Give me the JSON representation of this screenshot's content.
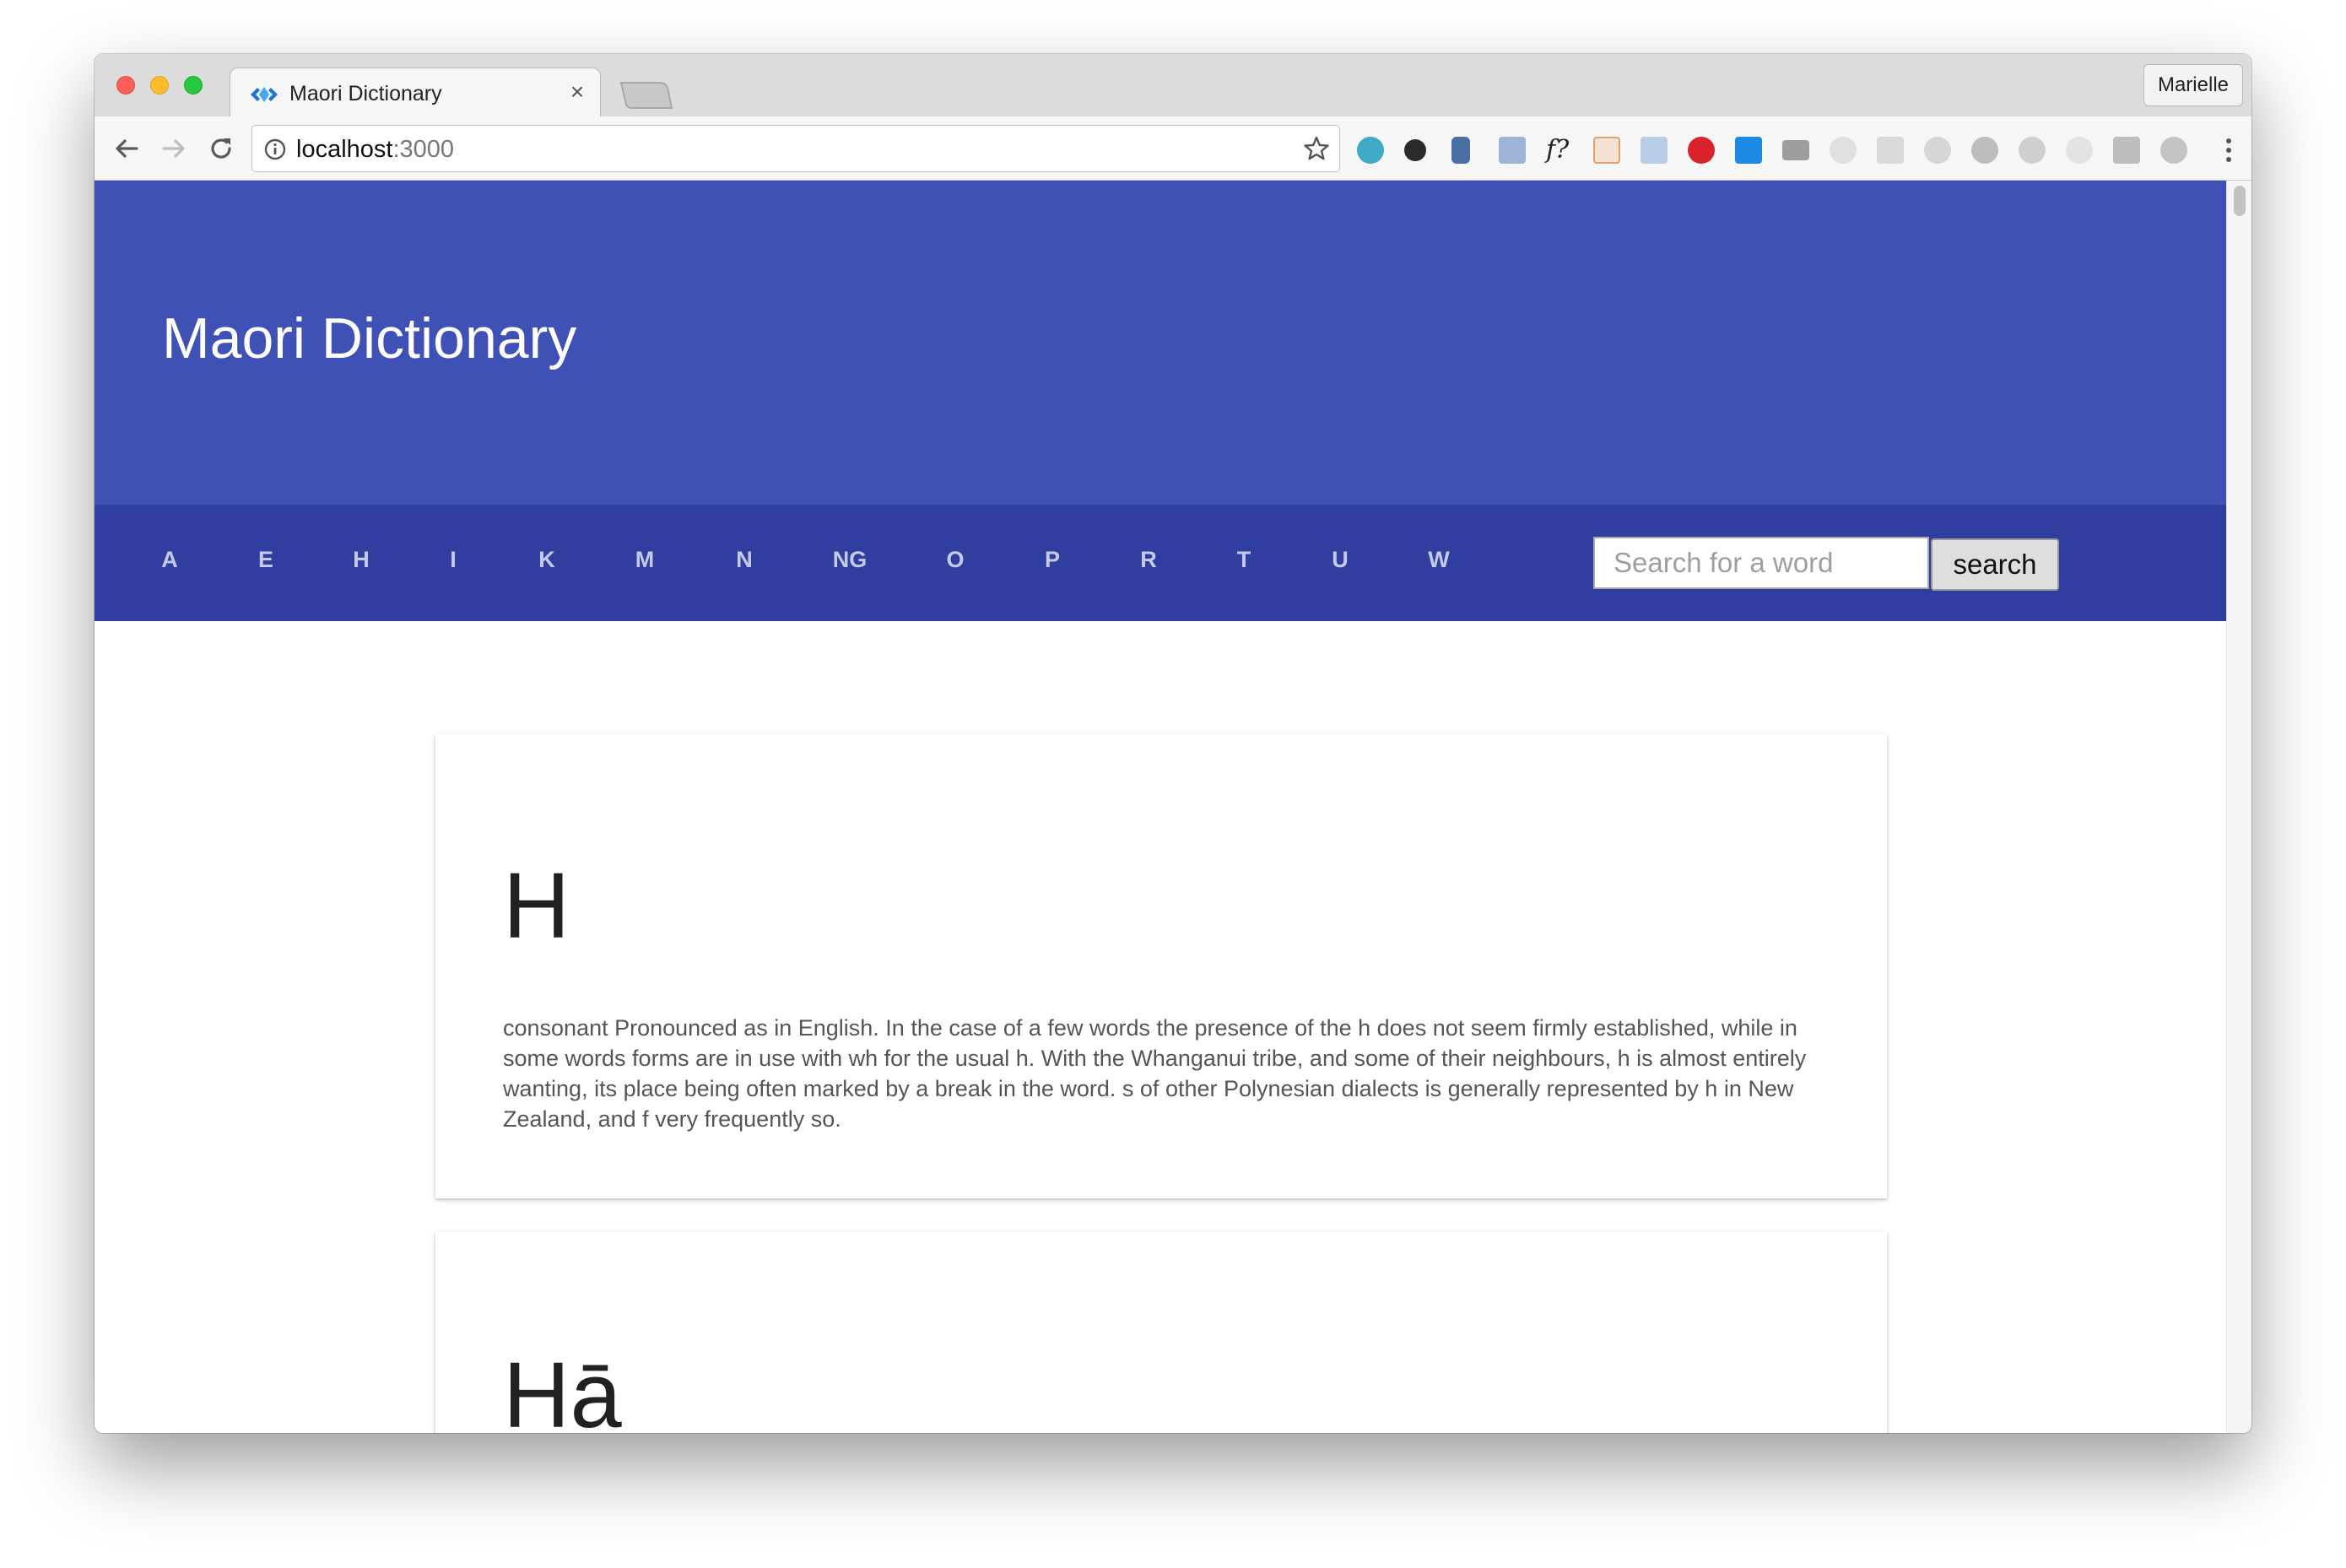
{
  "browser": {
    "tab": {
      "title": "Maori Dictionary",
      "close": "×"
    },
    "profile": "Marielle",
    "address": {
      "host": "localhost",
      "port": ":3000"
    }
  },
  "site": {
    "title": "Maori Dictionary",
    "letters": [
      "A",
      "E",
      "H",
      "I",
      "K",
      "M",
      "N",
      "NG",
      "O",
      "P",
      "R",
      "T",
      "U",
      "W"
    ],
    "search": {
      "placeholder": "Search for a word",
      "button": "search"
    }
  },
  "entries": [
    {
      "word": "H",
      "definition": "consonant Pronounced as in English. In the case of a few words the presence of the h does not seem firmly established, while in some words forms are in use with wh for the usual h. With the Whanganui tribe, and some of their neighbours, h is almost entirely wanting, its place being often marked by a break in the word. s of other Polynesian dialects is generally represented by h in New Zealand, and f very frequently so."
    },
    {
      "word": "Hā"
    }
  ],
  "colors": {
    "header": "#3f51b5",
    "nav": "#303f9f",
    "letter": "#c5cae9"
  },
  "icons": [
    "favicon-icon",
    "back-arrow-icon",
    "forward-arrow-icon",
    "reload-icon",
    "info-icon",
    "star-icon",
    "menu-dots-icon"
  ]
}
